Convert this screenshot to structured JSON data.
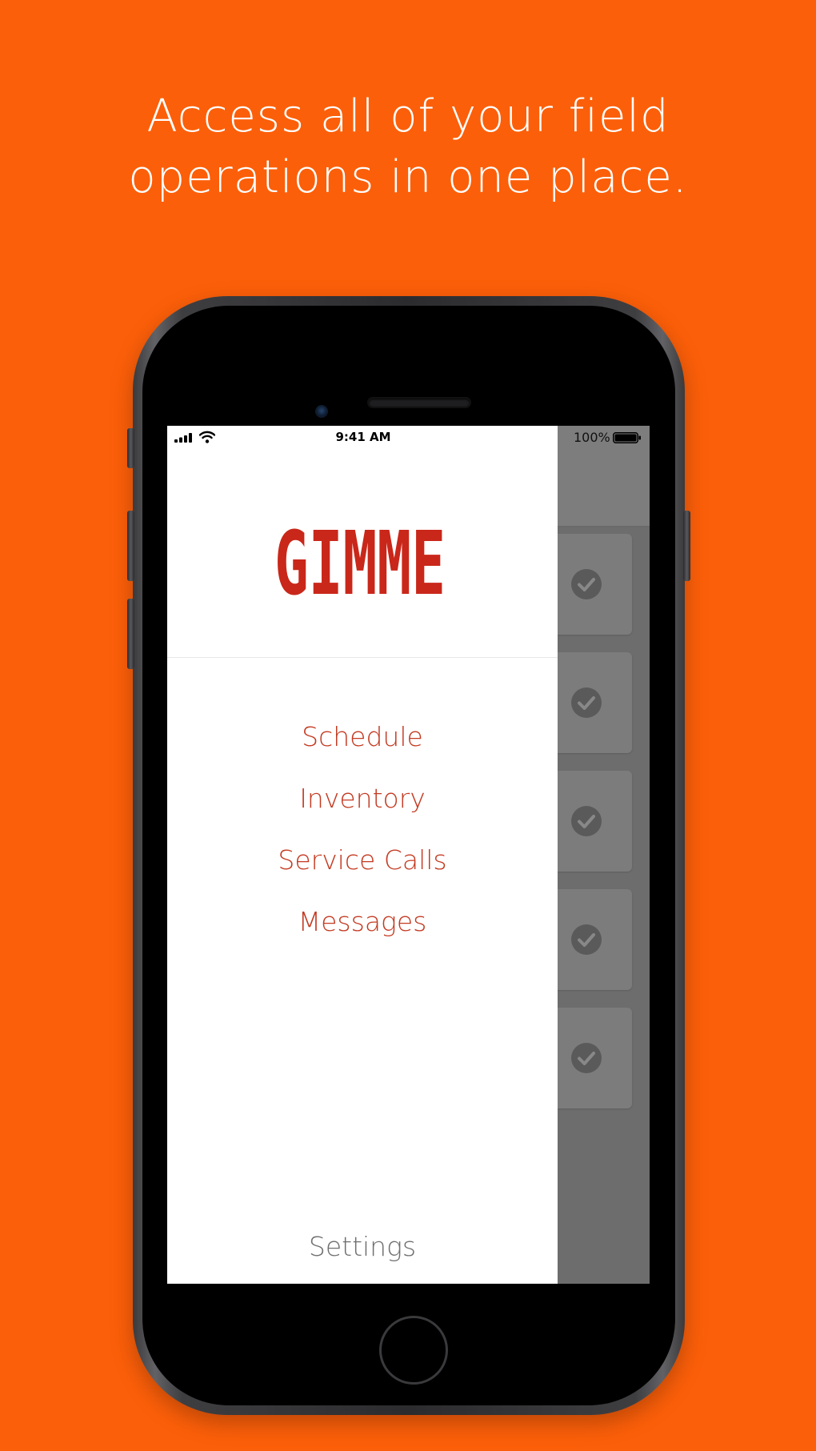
{
  "headline": {
    "line1": "Access all of your field",
    "line2": "operations in one place."
  },
  "status_bar": {
    "time": "9:41 AM",
    "battery_percent": "100%",
    "icons": [
      "signal-icon",
      "wifi-icon",
      "battery-icon"
    ]
  },
  "drawer": {
    "logo_text": "GIMME",
    "menu_items": [
      {
        "label": "Schedule"
      },
      {
        "label": "Inventory"
      },
      {
        "label": "Service Calls"
      },
      {
        "label": "Messages"
      }
    ],
    "settings_label": "Settings"
  },
  "background_list": {
    "card_count": 5,
    "card_icon": "check-circle-icon"
  },
  "colors": {
    "background": "#fc5f09",
    "brand_red": "#c9271a",
    "menu_text": "#c33a21",
    "settings_text": "#6f6f6f"
  }
}
